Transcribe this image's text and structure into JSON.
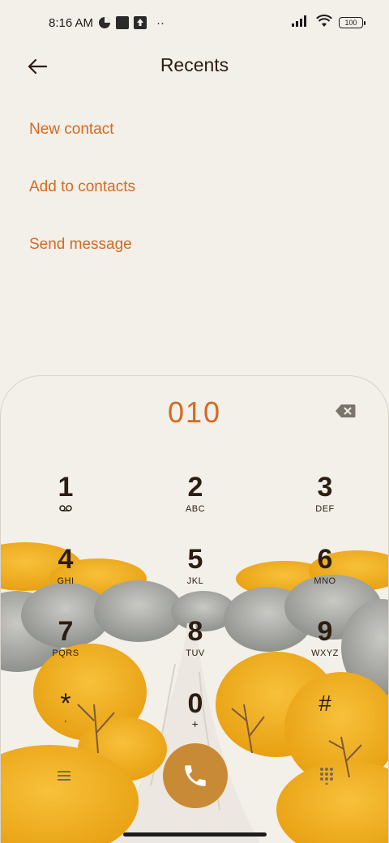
{
  "status_bar": {
    "time": "8:16 AM",
    "dots": "··",
    "battery": "100"
  },
  "header": {
    "title": "Recents"
  },
  "actions": [
    {
      "label": "New contact"
    },
    {
      "label": "Add to contacts"
    },
    {
      "label": "Send message"
    }
  ],
  "dialer": {
    "number": "010",
    "keys": [
      {
        "digit": "1",
        "letters": ""
      },
      {
        "digit": "2",
        "letters": "ABC"
      },
      {
        "digit": "3",
        "letters": "DEF"
      },
      {
        "digit": "4",
        "letters": "GHI"
      },
      {
        "digit": "5",
        "letters": "JKL"
      },
      {
        "digit": "6",
        "letters": "MNO"
      },
      {
        "digit": "7",
        "letters": "PQRS"
      },
      {
        "digit": "8",
        "letters": "TUV"
      },
      {
        "digit": "9",
        "letters": "WXYZ"
      },
      {
        "digit": "*",
        "letters": ","
      },
      {
        "digit": "0",
        "letters": "+"
      },
      {
        "digit": "#",
        "letters": ""
      }
    ]
  },
  "colors": {
    "accent": "#d46a1f",
    "call_button": "#c98a35",
    "background": "#f3efe9"
  },
  "icons": {
    "back": "arrow-left-icon",
    "backspace": "backspace-icon",
    "voicemail": "voicemail-icon",
    "menu": "menu-icon",
    "dialpad": "dialpad-icon",
    "call": "phone-icon"
  }
}
